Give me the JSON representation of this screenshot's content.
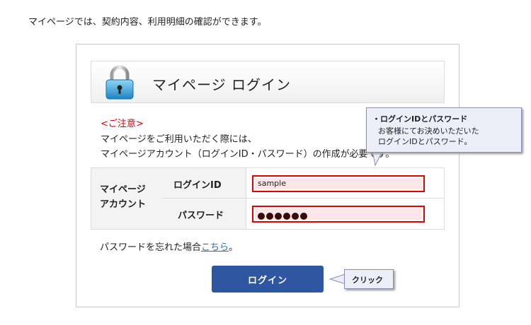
{
  "intro": "マイページでは、契約内容、利用明細の確認ができます。",
  "login_panel": {
    "title": "マイページ ログイン",
    "notice_title": "<ご注意>",
    "notice_line1": "マイページをご利用いただく際には、",
    "notice_line2": "マイページアカウント（ログインID・パスワード）の作成が必要です。",
    "account_label_line1": "マイページ",
    "account_label_line2": "アカウント",
    "login_id_label": "ログインID",
    "login_id_value": "sample",
    "password_label": "パスワード",
    "password_length": 6,
    "forgot_text": "パスワードを忘れた場合",
    "forgot_link": "こちら",
    "forgot_suffix": "。",
    "login_button": "ログイン"
  },
  "callout_credentials": {
    "title": "・ログインIDとパスワード",
    "line1": "お客様にてお決めいただいた",
    "line2": "ログインIDとパスワード。"
  },
  "callout_click": {
    "text": "クリック"
  },
  "icons": {
    "lock": "padlock-icon"
  },
  "colors": {
    "button": "#2f56a0",
    "field_border": "#e00000",
    "field_bg": "#ffe6e8",
    "notice": "#d40000",
    "link": "#1f6fb5",
    "callout_bg": "#eceef8"
  }
}
